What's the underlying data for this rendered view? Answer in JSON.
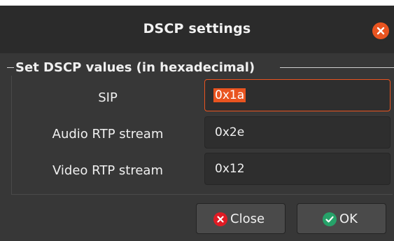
{
  "dialog": {
    "title": "DSCP settings",
    "close_icon": "close-x-icon",
    "accent_color": "#e95420"
  },
  "group": {
    "title": "Set DSCP values (in hexadecimal)"
  },
  "fields": {
    "sip": {
      "label": "SIP",
      "value": "0x1a"
    },
    "audio": {
      "label": "Audio RTP stream",
      "value": "0x2e"
    },
    "video": {
      "label": "Video RTP stream",
      "value": "0x12"
    }
  },
  "buttons": {
    "close_label": "Close",
    "ok_label": "OK",
    "close_icon_color": "#e01b24",
    "ok_icon_color": "#26a269"
  }
}
